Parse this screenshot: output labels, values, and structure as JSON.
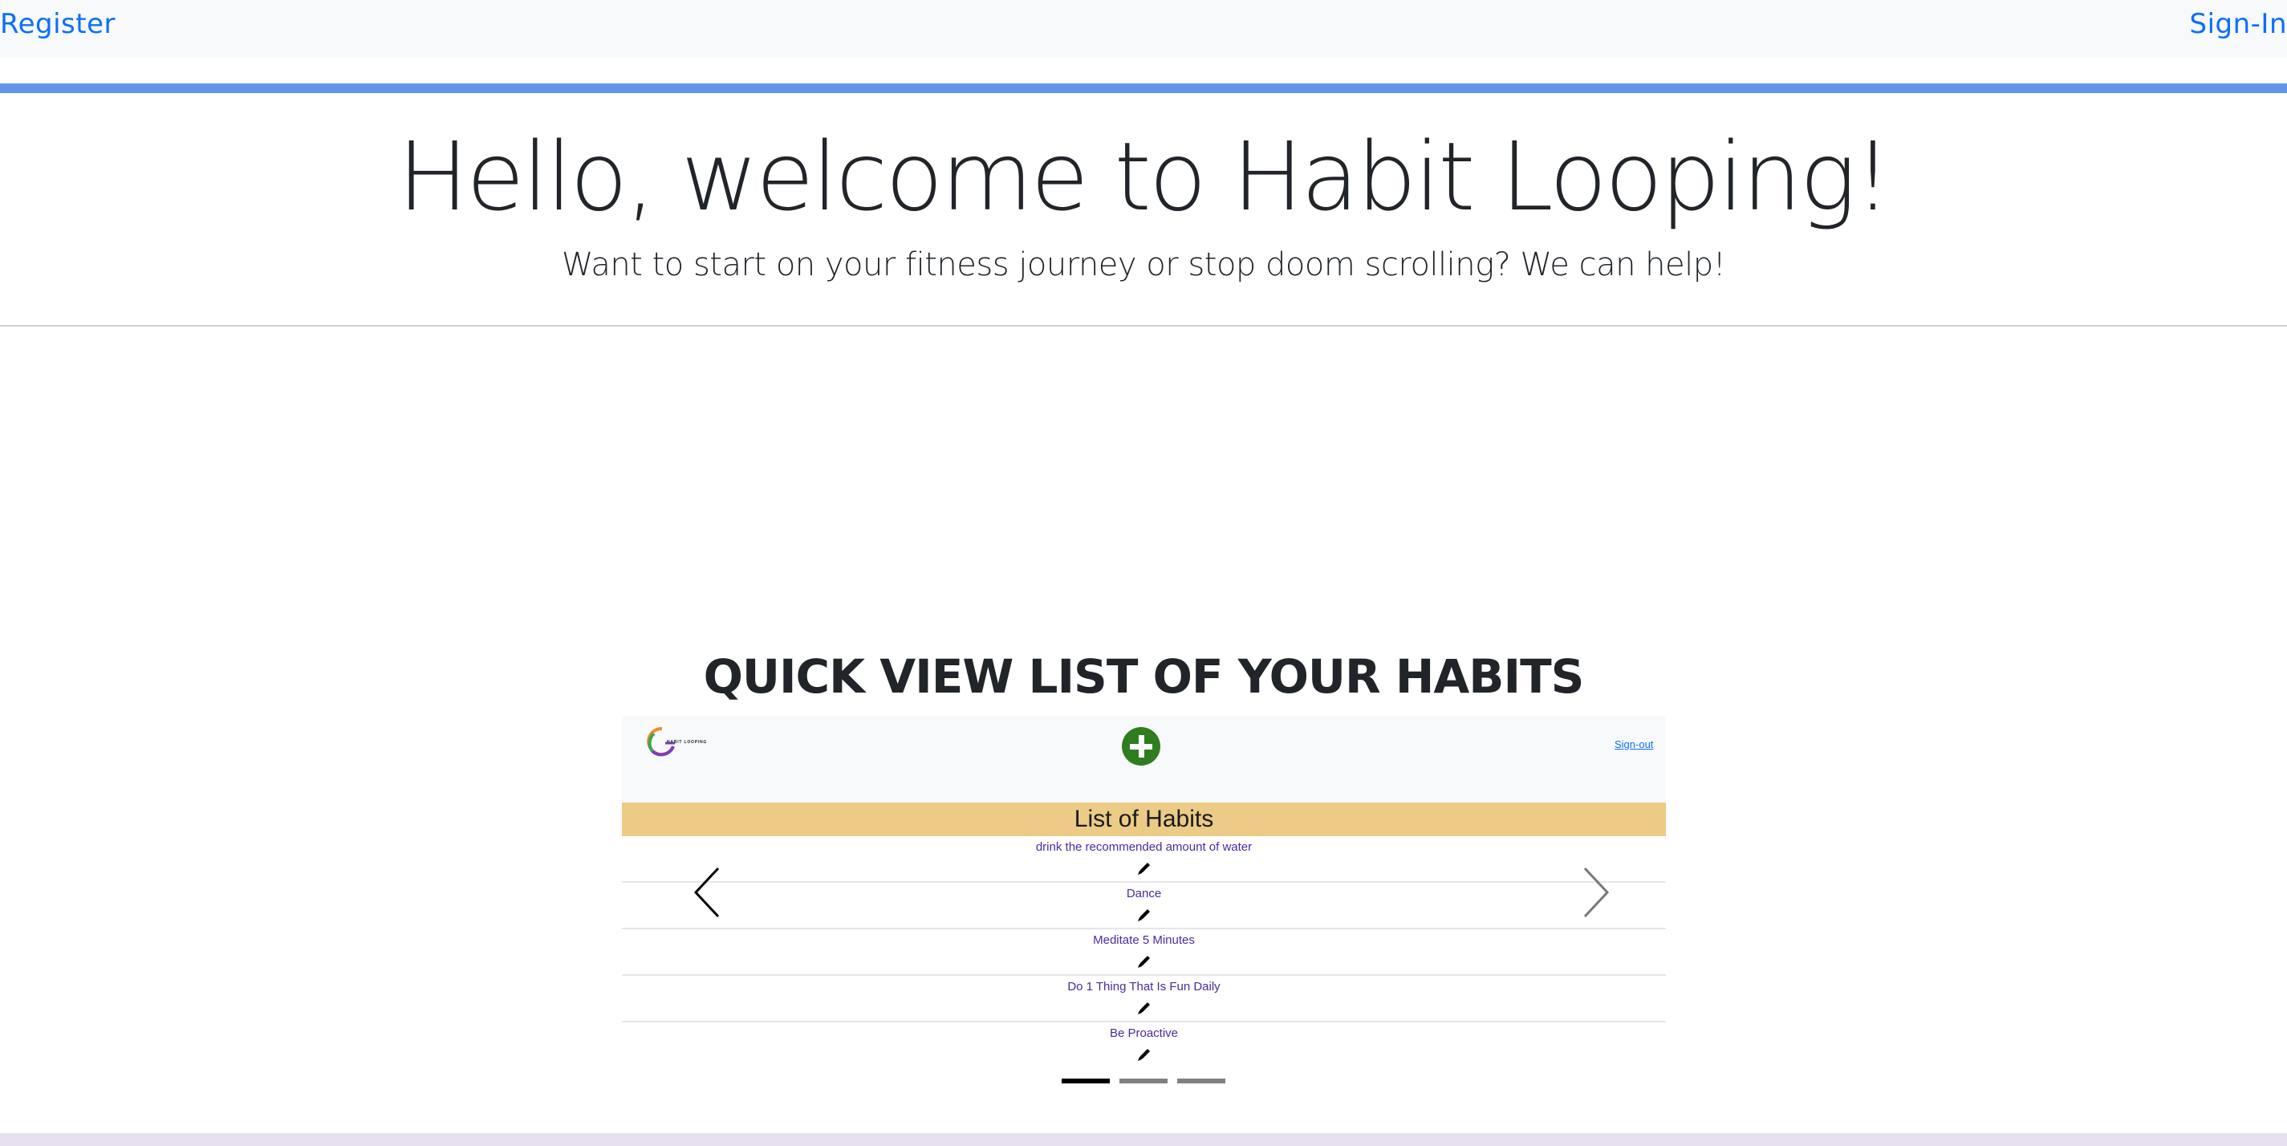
{
  "nav": {
    "register": "Register",
    "sign_in": "Sign-In"
  },
  "hero": {
    "title": "Hello, welcome to Habit Looping!",
    "subtitle": "Want to start on your fitness journey or stop doom scrolling? We can help!"
  },
  "quick_view": {
    "title": "QUICK VIEW LIST OF YOUR HABITS"
  },
  "slide": {
    "logo_text": "HABIT LOOPING",
    "add_icon": "plus-circle-icon",
    "sign_out": "Sign-out",
    "list_title": "List of Habits",
    "habits": [
      "drink the recommended amount of water",
      "Dance",
      "Meditate 5 Minutes",
      "Do 1 Thing That Is Fun Daily",
      "Be Proactive"
    ],
    "edit_icon": "pencil-icon"
  },
  "carousel": {
    "prev_icon": "chevron-left-icon",
    "next_icon": "chevron-right-icon",
    "slide_count": 3,
    "active_index": 0
  },
  "colors": {
    "link": "#0d6efd",
    "accent_bar": "#6495ed",
    "list_header_bg": "#ebcb85",
    "add_button": "#2e7d1f",
    "habit_text": "#4b2aa0"
  }
}
